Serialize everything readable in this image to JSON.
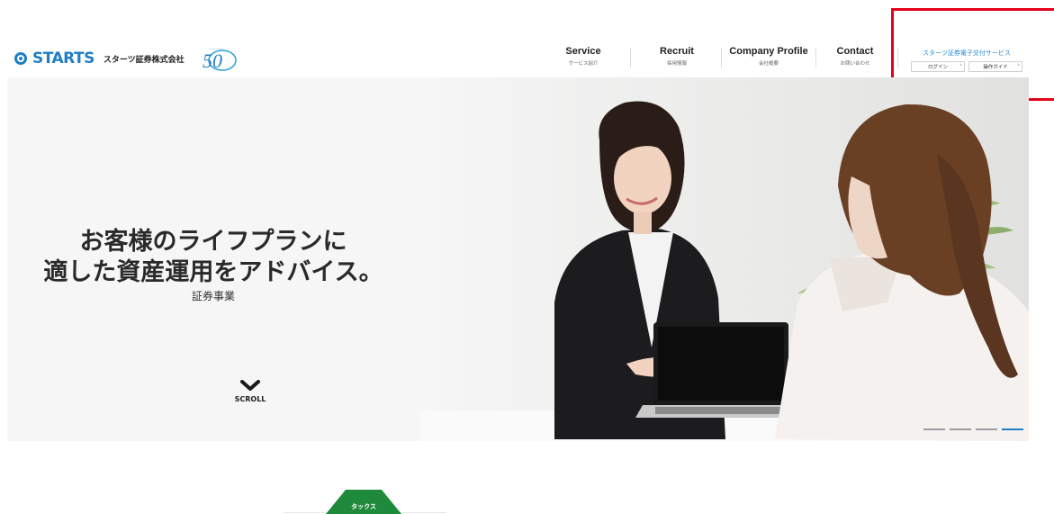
{
  "header": {
    "logo": {
      "word": "STARTS",
      "company": "スターツ証券株式会社",
      "anniversary": "50"
    },
    "nav": [
      {
        "en": "Service",
        "ja": "サービス紹介"
      },
      {
        "en": "Recruit",
        "ja": "採用情報"
      },
      {
        "en": "Company Profile",
        "ja": "会社概要"
      },
      {
        "en": "Contact",
        "ja": "お問い合わせ"
      }
    ],
    "eservice": {
      "title": "スターツ証券電子交付サービス",
      "login_label": "ログイン",
      "guide_label": "操作ガイド"
    }
  },
  "hero": {
    "headline_line1": "お客様のライフプランに",
    "headline_line2": "適した資産運用をアドバイス。",
    "subtitle": "証券事業",
    "scroll_label": "SCROLL",
    "slides_total": 4,
    "active_slide": 4
  },
  "bottom": {
    "tab_label": "タックス"
  },
  "colors": {
    "brand_blue": "#1f7fc6",
    "eservice_blue": "#2a8ad4",
    "highlight_red": "#e3001b",
    "tab_green": "#1f8a3c"
  },
  "icons": {
    "scroll": "chevron-down-icon",
    "logo": "starts-logo-icon"
  }
}
